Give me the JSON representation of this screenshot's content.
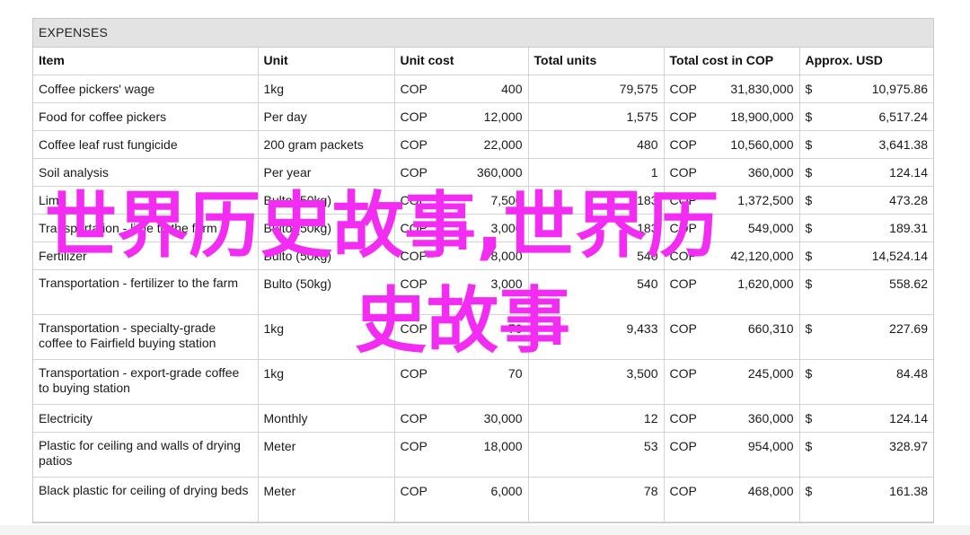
{
  "sheet": {
    "title": "EXPENSES",
    "headers": {
      "item": "Item",
      "unit": "Unit",
      "unit_cost": "Unit cost",
      "total_units": "Total units",
      "total_cop": "Total cost in COP",
      "usd": "Approx. USD"
    },
    "currency_cop": "COP",
    "currency_usd": "$",
    "rows": [
      {
        "item": "Coffee pickers' wage",
        "unit": "1kg",
        "unit_cost": "400",
        "total_units": "79,575",
        "total_cop": "31,830,000",
        "usd": "10,975.86"
      },
      {
        "item": "Food for coffee pickers",
        "unit": "Per day",
        "unit_cost": "12,000",
        "total_units": "1,575",
        "total_cop": "18,900,000",
        "usd": "6,517.24"
      },
      {
        "item": "Coffee leaf rust fungicide",
        "unit": "200 gram packets",
        "unit_cost": "22,000",
        "total_units": "480",
        "total_cop": "10,560,000",
        "usd": "3,641.38"
      },
      {
        "item": "Soil analysis",
        "unit": "Per year",
        "unit_cost": "360,000",
        "total_units": "1",
        "total_cop": "360,000",
        "usd": "124.14"
      },
      {
        "item": "Lime",
        "unit": "Bulto (50kg)",
        "unit_cost": "7,500",
        "total_units": "183",
        "total_cop": "1,372,500",
        "usd": "473.28"
      },
      {
        "item": "Transportation - lime to the farm",
        "unit": "Bulto (50kg)",
        "unit_cost": "3,000",
        "total_units": "183",
        "total_cop": "549,000",
        "usd": "189.31"
      },
      {
        "item": "Fertilizer",
        "unit": "Bulto (50kg)",
        "unit_cost": "78,000",
        "total_units": "540",
        "total_cop": "42,120,000",
        "usd": "14,524.14"
      },
      {
        "item": "Transportation - fertilizer to the farm",
        "unit": "Bulto (50kg)",
        "unit_cost": "3,000",
        "total_units": "540",
        "total_cop": "1,620,000",
        "usd": "558.62"
      },
      {
        "item": "Transportation - specialty-grade coffee to Fairfield buying station",
        "unit": "1kg",
        "unit_cost": "70",
        "total_units": "9,433",
        "total_cop": "660,310",
        "usd": "227.69"
      },
      {
        "item": "Transportation - export-grade coffee to buying station",
        "unit": "1kg",
        "unit_cost": "70",
        "total_units": "3,500",
        "total_cop": "245,000",
        "usd": "84.48"
      },
      {
        "item": "Electricity",
        "unit": "Monthly",
        "unit_cost": "30,000",
        "total_units": "12",
        "total_cop": "360,000",
        "usd": "124.14"
      },
      {
        "item": "Plastic for ceiling and walls of drying patios",
        "unit": "Meter",
        "unit_cost": "18,000",
        "total_units": "53",
        "total_cop": "954,000",
        "usd": "328.97"
      },
      {
        "item": "Black plastic for ceiling of drying beds",
        "unit": "Meter",
        "unit_cost": "6,000",
        "total_units": "78",
        "total_cop": "468,000",
        "usd": "161.38"
      }
    ]
  },
  "watermark": {
    "line1": "世界历史故事,世界历",
    "line2": "史故事",
    "color": "#f22cf2"
  }
}
